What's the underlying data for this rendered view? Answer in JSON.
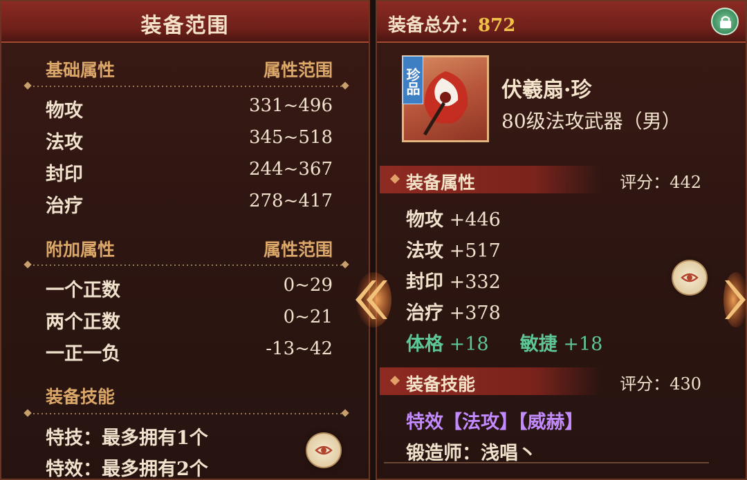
{
  "left": {
    "title": "装备范围",
    "base": {
      "header": "基础属性",
      "range_header": "属性范围",
      "rows": [
        {
          "name": "物攻",
          "range": "331~496"
        },
        {
          "name": "法攻",
          "range": "345~518"
        },
        {
          "name": "封印",
          "range": "244~367"
        },
        {
          "name": "治疗",
          "range": "278~417"
        }
      ]
    },
    "extra": {
      "header": "附加属性",
      "range_header": "属性范围",
      "rows": [
        {
          "name": "一个正数",
          "range": "0~29"
        },
        {
          "name": "两个正数",
          "range": "0~21"
        },
        {
          "name": "一正一负",
          "range": "-13~42"
        }
      ]
    },
    "skills": {
      "header": "装备技能",
      "lines": [
        "特技：最多拥有1个",
        "特效：最多拥有2个"
      ]
    }
  },
  "right": {
    "score_label": "装备总分：",
    "score_value": "872",
    "item": {
      "rarity": "珍品",
      "name": "伏羲扇·珍",
      "type": "80级法攻武器（男）"
    },
    "attributes": {
      "header": "装备属性",
      "score": "评分：442",
      "rows": [
        {
          "name": "物攻",
          "value": "+446"
        },
        {
          "name": "法攻",
          "value": "+517"
        },
        {
          "name": "封印",
          "value": "+332"
        },
        {
          "name": "治疗",
          "value": "+378"
        }
      ],
      "extra": [
        {
          "name": "体格",
          "value": "+18"
        },
        {
          "name": "敏捷",
          "value": "+18"
        }
      ]
    },
    "skills": {
      "header": "装备技能",
      "score": "评分：430",
      "effect_line": "特效【法攻】【威赫】",
      "forger": "锻造师：浅唱丶"
    }
  },
  "colors": {
    "panel": "#2e1612",
    "header_red": "#7a231c",
    "gold_text": "#dca86a",
    "score_gold": "#f0c24a",
    "green_stat": "#5ec79a",
    "purple_effect": "#c28aff",
    "rarity_blue": "#3e7fc4"
  },
  "icons": [
    "lock-icon",
    "eye-icon",
    "chevron-left-icon",
    "chevron-right-icon",
    "diamond-icon"
  ]
}
